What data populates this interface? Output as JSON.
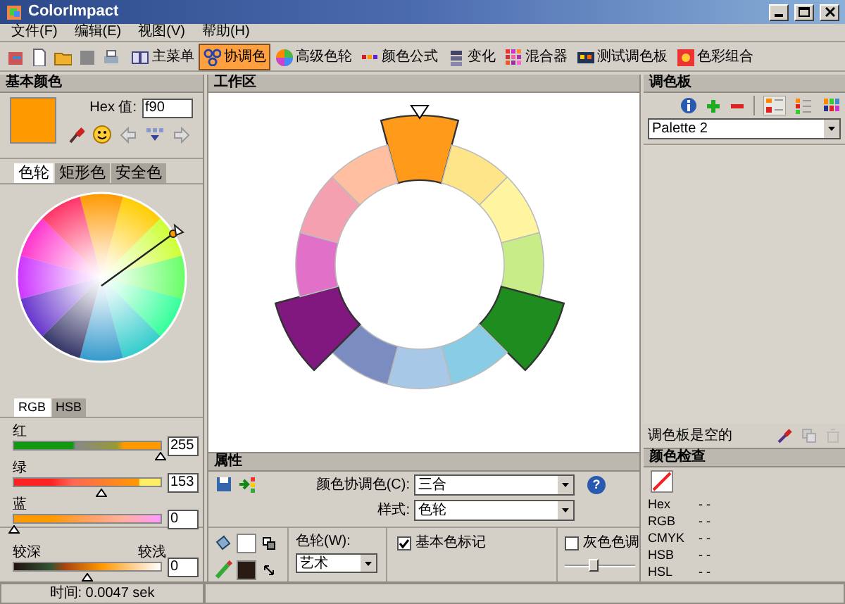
{
  "window": {
    "title": "ColorImpact"
  },
  "menu": [
    "文件(F)",
    "编辑(E)",
    "视图(V)",
    "帮助(H)"
  ],
  "modes": [
    {
      "label": "主菜单",
      "selected": false
    },
    {
      "label": "协调色",
      "selected": true
    },
    {
      "label": "高级色轮",
      "selected": false
    },
    {
      "label": "颜色公式",
      "selected": false
    },
    {
      "label": "变化",
      "selected": false
    },
    {
      "label": "混合器",
      "selected": false
    },
    {
      "label": "测试调色板",
      "selected": false
    },
    {
      "label": "色彩组合",
      "selected": false
    }
  ],
  "basic_color": {
    "title": "基本颜色",
    "hex_label": "Hex 值:",
    "hex_value": "f90",
    "tabs": [
      {
        "label": "色轮",
        "selected": true
      },
      {
        "label": "矩形色",
        "selected": false
      },
      {
        "label": "安全色",
        "selected": false
      }
    ],
    "slider_tabs": [
      {
        "label": "RGB",
        "selected": true
      },
      {
        "label": "HSB",
        "selected": false
      }
    ],
    "sliders": [
      {
        "label": "红",
        "level": 1.0,
        "value": "255"
      },
      {
        "label": "绿",
        "level": 0.6,
        "value": "153"
      },
      {
        "label": "蓝",
        "level": 0.0,
        "value": "0"
      }
    ],
    "shade": {
      "darker": "较深",
      "lighter": "较浅",
      "level": 0.5,
      "value": "0"
    }
  },
  "status_bar": {
    "text": "时间: 0.0047 sek"
  },
  "workspace": {
    "title": "工作区",
    "segments": [
      {
        "color": "#ff9a1a",
        "highlighted": true
      },
      {
        "color": "#ffe58a",
        "highlighted": false
      },
      {
        "color": "#fff5a0",
        "highlighted": false
      },
      {
        "color": "#c8ec88",
        "highlighted": false
      },
      {
        "color": "#1e8c1e",
        "highlighted": true
      },
      {
        "color": "#88cce6",
        "highlighted": false
      },
      {
        "color": "#a8c8e8",
        "highlighted": false
      },
      {
        "color": "#7a8cc0",
        "highlighted": false
      },
      {
        "color": "#801880",
        "highlighted": true
      },
      {
        "color": "#e070c8",
        "highlighted": false
      },
      {
        "color": "#f4a0b0",
        "highlighted": false
      },
      {
        "color": "#ffbfa0",
        "highlighted": false
      }
    ]
  },
  "properties": {
    "title": "属性",
    "harmony_label": "颜色协调色(C):",
    "harmony_value": "三合",
    "style_label": "样式:",
    "style_value": "色轮",
    "wheel_label": "色轮(W):",
    "wheel_value": "艺术",
    "checkboxes": [
      {
        "label": "基本色标记",
        "checked": true
      },
      {
        "label": "灰色色调",
        "checked": false
      }
    ],
    "help": "?",
    "gray_slider": {
      "level": 0.4
    }
  },
  "palette": {
    "title": "调色板",
    "select_value": "Palette 2",
    "empty_text": "调色板是空的"
  },
  "color_check": {
    "title": "颜色检查",
    "rows": [
      {
        "label": "Hex",
        "value": "- -"
      },
      {
        "label": "RGB",
        "value": "- -"
      },
      {
        "label": "CMYK",
        "value": "- -"
      },
      {
        "label": "HSB",
        "value": "- -"
      },
      {
        "label": "HSL",
        "value": "- -"
      }
    ]
  }
}
